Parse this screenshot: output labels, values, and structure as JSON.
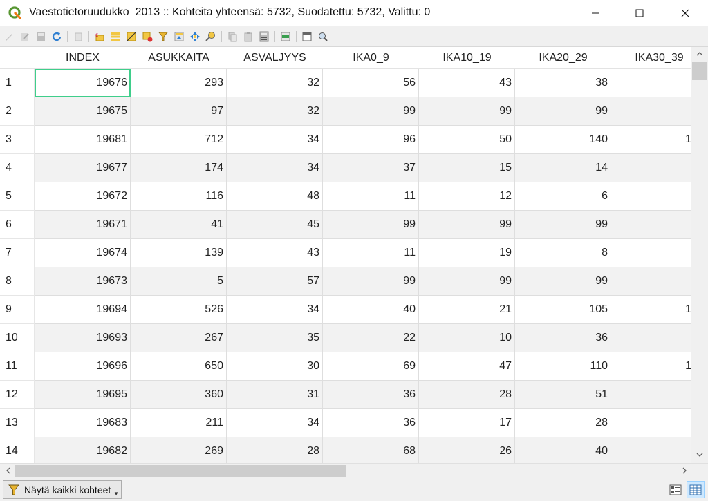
{
  "window": {
    "title": "Vaestotietoruudukko_2013 :: Kohteita yhteensä: 5732, Suodatettu: 5732, Valittu: 0"
  },
  "toolbar": {
    "icons": [
      "pencil-icon",
      "multi-edit-icon",
      "save-icon",
      "reload-icon",
      "add-feature-icon",
      "delete-feature-icon",
      "select-expression-icon",
      "select-all-icon",
      "invert-selection-icon",
      "deselect-all-icon",
      "filter-select-icon",
      "move-selection-top-icon",
      "pan-to-selection-icon",
      "zoom-to-selection-icon",
      "copy-icon",
      "paste-icon",
      "field-calculator-icon",
      "conditional-format-icon",
      "dock-icon",
      "actions-icon"
    ]
  },
  "table": {
    "columns": [
      "INDEX",
      "ASUKKAITA",
      "ASVALJYYS",
      "IKA0_9",
      "IKA10_19",
      "IKA20_29",
      "IKA30_39"
    ],
    "rows": [
      {
        "num": "1",
        "cells": [
          "19676",
          "293",
          "32",
          "56",
          "43",
          "38",
          ""
        ]
      },
      {
        "num": "2",
        "cells": [
          "19675",
          "97",
          "32",
          "99",
          "99",
          "99",
          ""
        ]
      },
      {
        "num": "3",
        "cells": [
          "19681",
          "712",
          "34",
          "96",
          "50",
          "140",
          "1"
        ]
      },
      {
        "num": "4",
        "cells": [
          "19677",
          "174",
          "34",
          "37",
          "15",
          "14",
          ""
        ]
      },
      {
        "num": "5",
        "cells": [
          "19672",
          "116",
          "48",
          "11",
          "12",
          "6",
          ""
        ]
      },
      {
        "num": "6",
        "cells": [
          "19671",
          "41",
          "45",
          "99",
          "99",
          "99",
          ""
        ]
      },
      {
        "num": "7",
        "cells": [
          "19674",
          "139",
          "43",
          "11",
          "19",
          "8",
          ""
        ]
      },
      {
        "num": "8",
        "cells": [
          "19673",
          "5",
          "57",
          "99",
          "99",
          "99",
          ""
        ]
      },
      {
        "num": "9",
        "cells": [
          "19694",
          "526",
          "34",
          "40",
          "21",
          "105",
          "1"
        ]
      },
      {
        "num": "10",
        "cells": [
          "19693",
          "267",
          "35",
          "22",
          "10",
          "36",
          ""
        ]
      },
      {
        "num": "11",
        "cells": [
          "19696",
          "650",
          "30",
          "69",
          "47",
          "110",
          "1"
        ]
      },
      {
        "num": "12",
        "cells": [
          "19695",
          "360",
          "31",
          "36",
          "28",
          "51",
          ""
        ]
      },
      {
        "num": "13",
        "cells": [
          "19683",
          "211",
          "34",
          "36",
          "17",
          "28",
          ""
        ]
      },
      {
        "num": "14",
        "cells": [
          "19682",
          "269",
          "28",
          "68",
          "26",
          "40",
          ""
        ]
      }
    ]
  },
  "bottom": {
    "filter_label": "Näytä kaikki kohteet"
  },
  "colors": {
    "selection_border": "#3fce8b",
    "alt_row": "#f2f2f2",
    "qgis_green": "#589632",
    "qgis_yellow": "#ee7913"
  }
}
